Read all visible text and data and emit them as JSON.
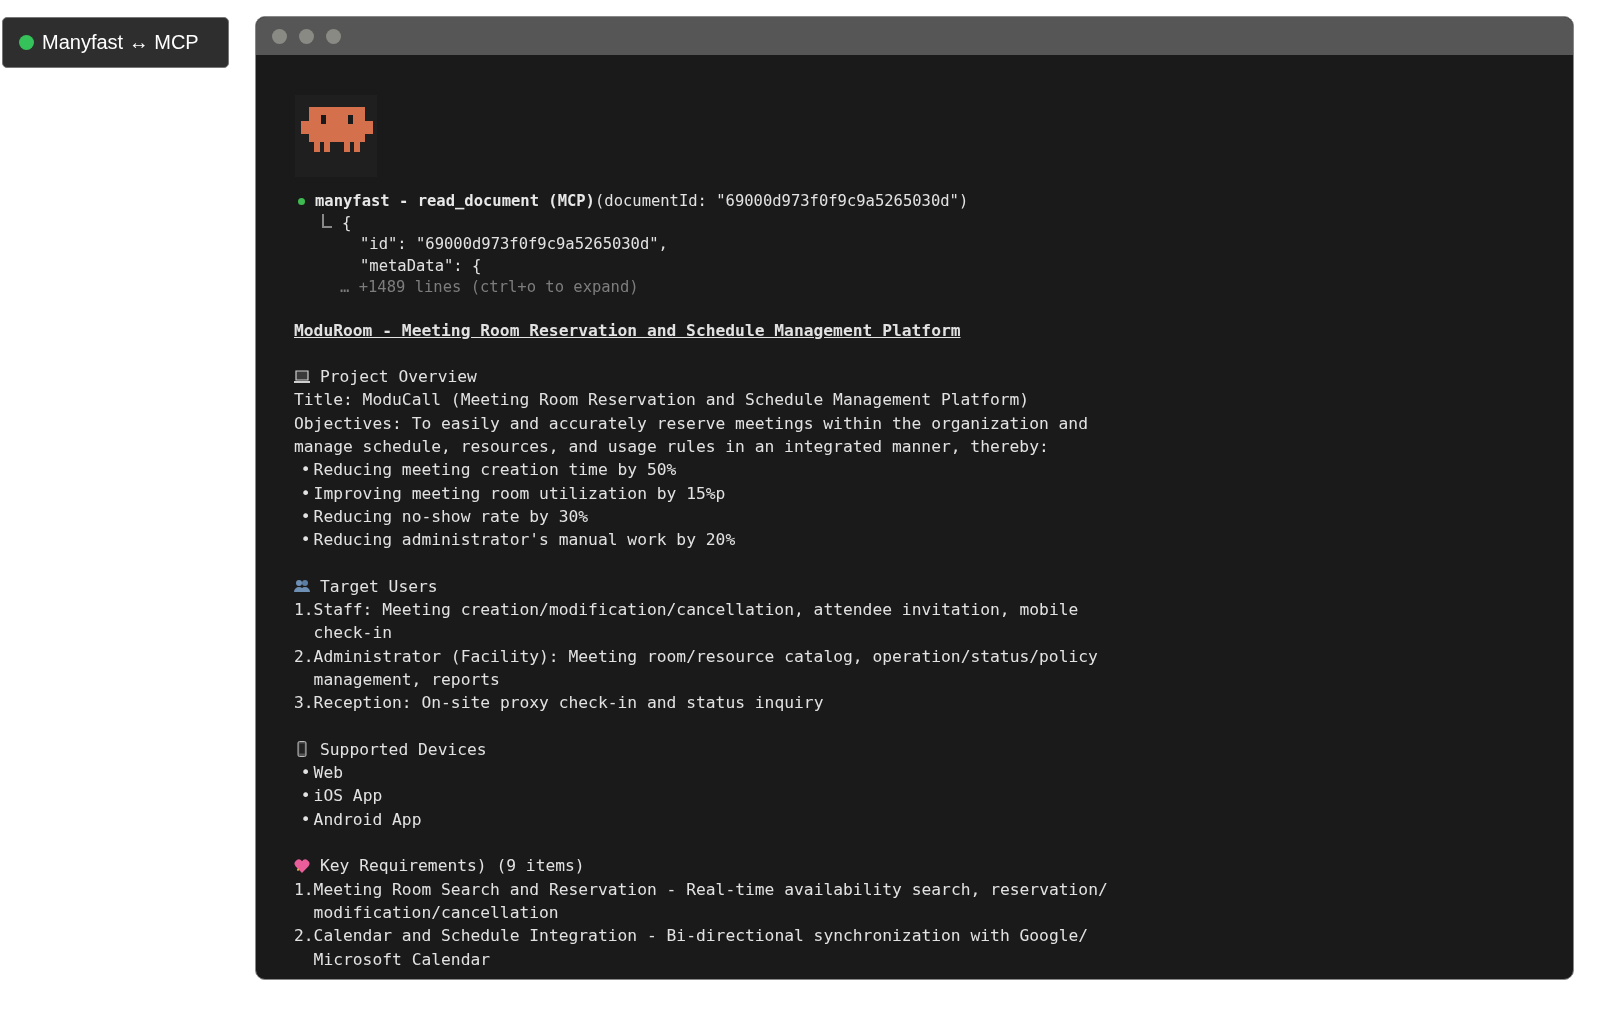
{
  "badge": {
    "label": "Manyfast ↔ MCP",
    "connected": true
  },
  "window": {
    "tool_call": {
      "done": true,
      "name": "manyfast - read_document (MCP)",
      "args": "(documentId: \"69000d973f0f9c9a5265030d\")",
      "output": [
        "{",
        "\"id\": \"69000d973f0f9c9a5265030d\",",
        "\"metaData\": {"
      ],
      "more": "… +1489 lines (ctrl+o to expand)"
    },
    "document": {
      "title": "ModuRoom - Meeting Room Reservation and Schedule Management Platform",
      "sections": [
        {
          "kind": "laptop",
          "heading": "Project Overview",
          "lines": [
            {
              "kind": "text",
              "text": "Title: ModuCall (Meeting Room Reservation and Schedule Management Platform)"
            },
            {
              "kind": "text",
              "text": "Objectives: To easily and accurately reserve meetings within the organization and manage schedule, resources, and usage rules in an integrated manner, thereby:"
            },
            {
              "kind": "bullet",
              "marker": "•",
              "text": "Reducing meeting creation time by 50%"
            },
            {
              "kind": "bullet",
              "marker": "•",
              "text": "Improving meeting room utilization by 15%p"
            },
            {
              "kind": "bullet",
              "marker": "•",
              "text": "Reducing no-show rate by 30%"
            },
            {
              "kind": "bullet",
              "marker": "•",
              "text": "Reducing administrator's manual work by 20%"
            }
          ]
        },
        {
          "kind": "people",
          "heading": "Target Users",
          "lines": [
            {
              "kind": "numbered",
              "marker": "1.",
              "text": "Staff: Meeting creation/modification/cancellation, attendee invitation, mobile check-in"
            },
            {
              "kind": "numbered",
              "marker": "2.",
              "text": "Administrator (Facility): Meeting room/resource catalog, operation/status/policy management, reports"
            },
            {
              "kind": "numbered",
              "marker": "3.",
              "text": "Reception: On-site proxy check-in and status inquiry"
            }
          ]
        },
        {
          "kind": "phone",
          "heading": "Supported Devices",
          "lines": [
            {
              "kind": "bullet",
              "marker": "•",
              "text": "Web"
            },
            {
              "kind": "bullet",
              "marker": "•",
              "text": "iOS App"
            },
            {
              "kind": "bullet",
              "marker": "•",
              "text": "Android App"
            }
          ]
        },
        {
          "kind": "heart",
          "heading": "Key Requirements) (9 items)",
          "lines": [
            {
              "kind": "numbered",
              "marker": "1.",
              "text": "Meeting Room Search and Reservation - Real-time availability search, reservation/modification/cancellation"
            },
            {
              "kind": "numbered",
              "marker": "2.",
              "text": "Calendar and Schedule Integration - Bi-directional synchronization with Google/Microsoft Calendar"
            }
          ]
        }
      ]
    }
  }
}
